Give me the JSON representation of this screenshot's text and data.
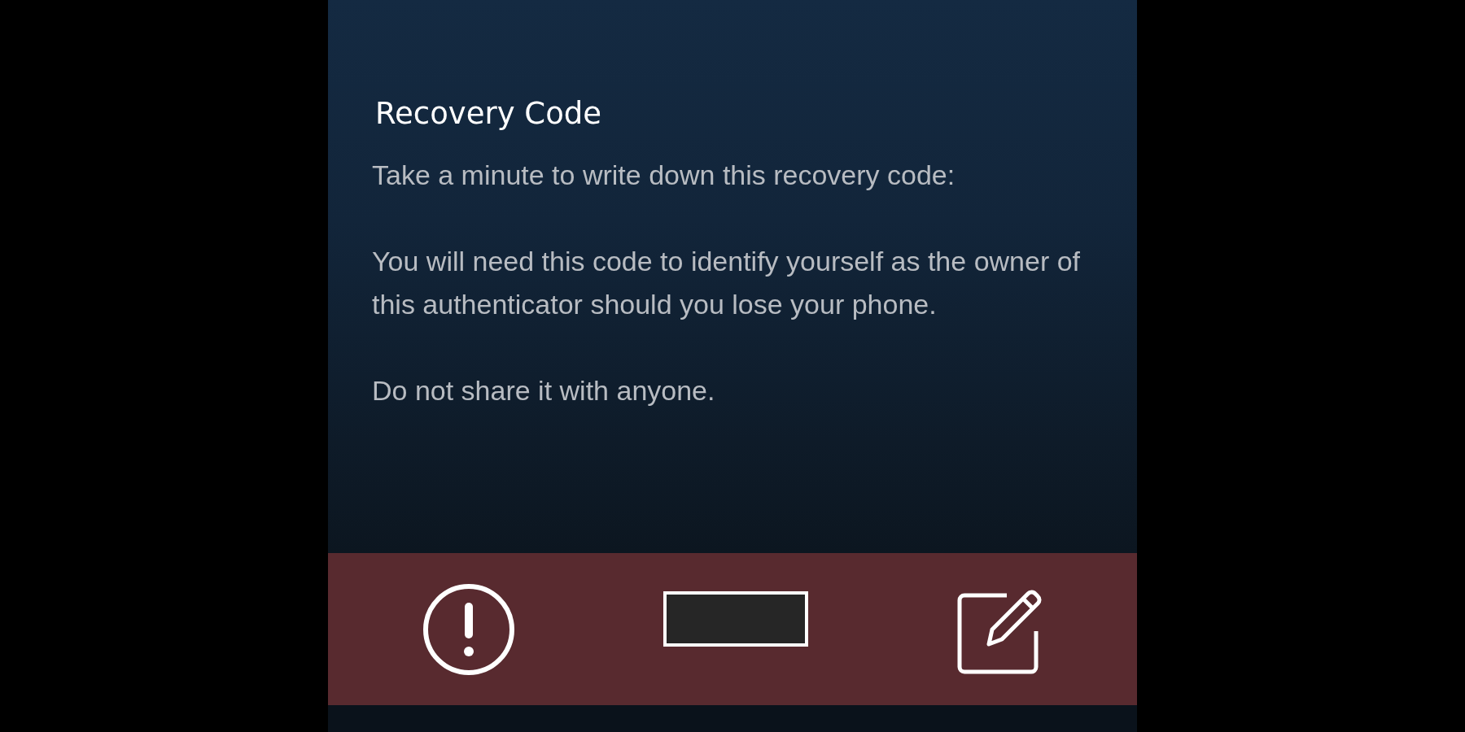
{
  "dialog": {
    "title": "Recovery Code",
    "paragraphs": [
      "Take a minute to write down this recovery code:",
      "You will need this code to identify yourself as the owner of this authenticator should you lose your phone.",
      "Do not share it with anyone."
    ]
  }
}
